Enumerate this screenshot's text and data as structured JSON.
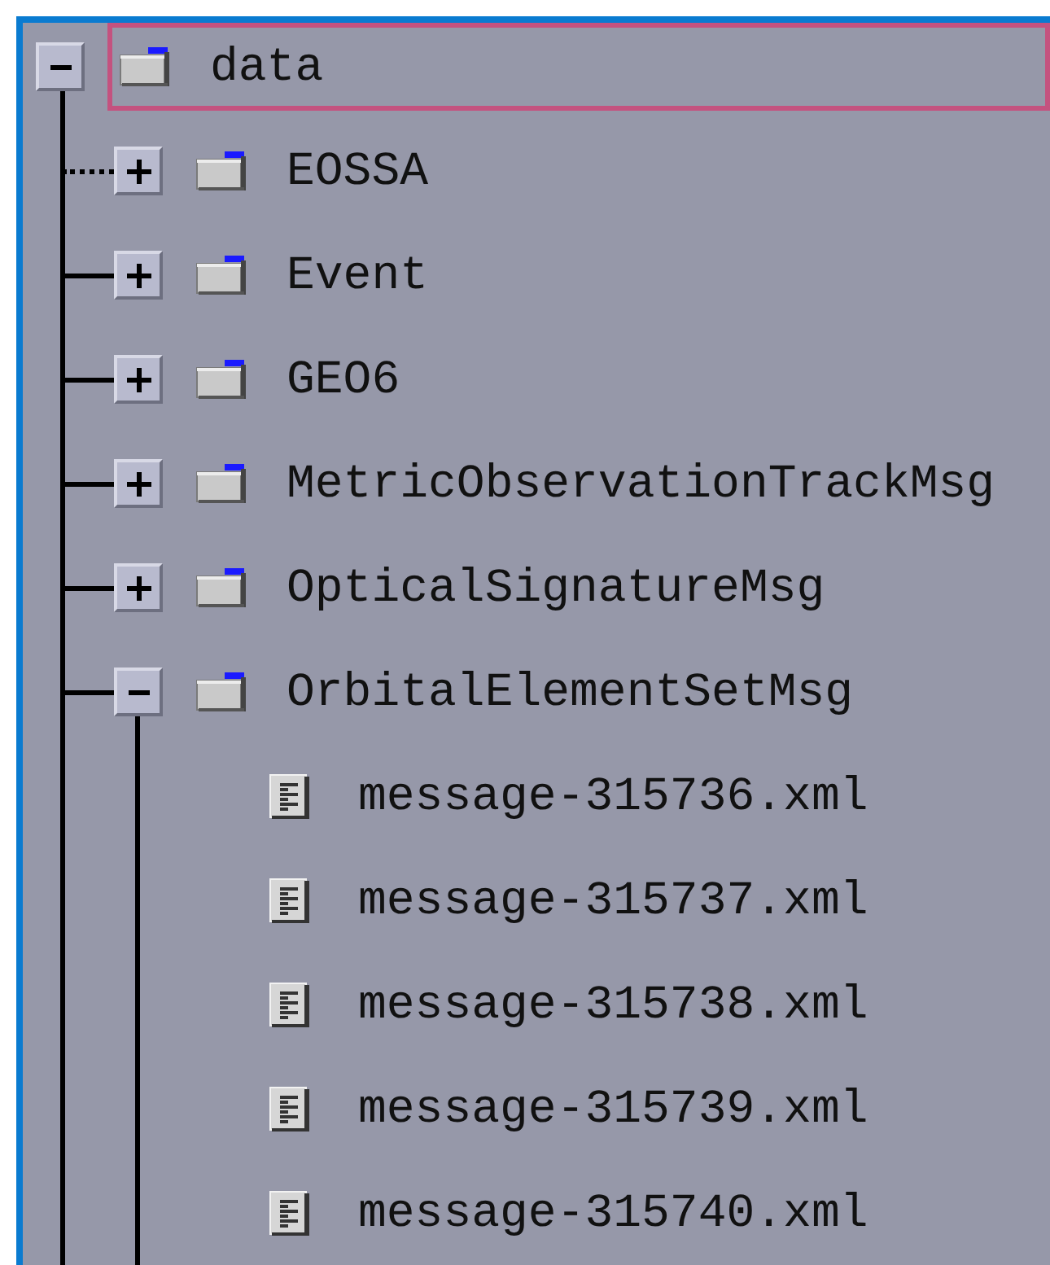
{
  "tree": {
    "kind": "folder",
    "label": "data",
    "expanded": true,
    "selected": true,
    "children": [
      {
        "kind": "folder",
        "label": "EOSSA",
        "expanded": false,
        "selected": false,
        "dotted_connector": true
      },
      {
        "kind": "folder",
        "label": "Event",
        "expanded": false,
        "selected": false,
        "dotted_connector": false
      },
      {
        "kind": "folder",
        "label": "GEO6",
        "expanded": false,
        "selected": false,
        "dotted_connector": false
      },
      {
        "kind": "folder",
        "label": "MetricObservationTrackMsg",
        "expanded": false,
        "selected": false,
        "dotted_connector": false
      },
      {
        "kind": "folder",
        "label": "OpticalSignatureMsg",
        "expanded": false,
        "selected": false,
        "dotted_connector": false
      },
      {
        "kind": "folder",
        "label": "OrbitalElementSetMsg",
        "expanded": true,
        "selected": false,
        "dotted_connector": false,
        "children": [
          {
            "kind": "file",
            "label": "message-315736.xml",
            "selected": false
          },
          {
            "kind": "file",
            "label": "message-315737.xml",
            "selected": false
          },
          {
            "kind": "file",
            "label": "message-315738.xml",
            "selected": false
          },
          {
            "kind": "file",
            "label": "message-315739.xml",
            "selected": false
          },
          {
            "kind": "file",
            "label": "message-315740.xml",
            "selected": false
          }
        ]
      }
    ]
  }
}
